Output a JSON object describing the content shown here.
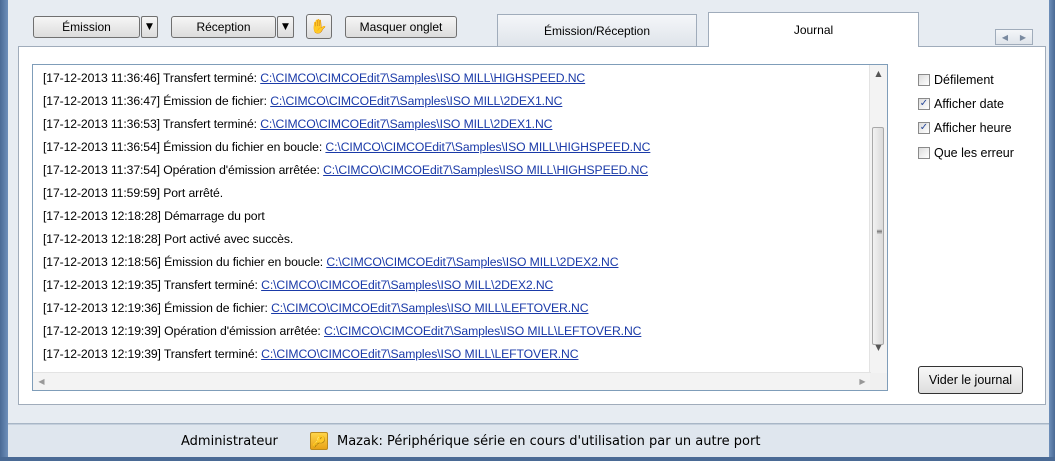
{
  "toolbar": {
    "emission_label": "Émission",
    "reception_label": "Réception",
    "hide_tabs_label": "Masquer onglet",
    "dropdown_glyph": "▼",
    "hand_glyph": "✋"
  },
  "tabs": [
    {
      "label": "Émission/Réception",
      "active": false
    },
    {
      "label": "Journal",
      "active": true
    }
  ],
  "tab_scroll": {
    "left": "◀",
    "right": "▶"
  },
  "log": {
    "lines": [
      {
        "text": "[17-12-2013 11:36:46] Transfert terminé: ",
        "link": "C:\\CIMCO\\CIMCOEdit7\\Samples\\ISO MILL\\HIGHSPEED.NC"
      },
      {
        "text": "[17-12-2013 11:36:47] Émission de fichier: ",
        "link": "C:\\CIMCO\\CIMCOEdit7\\Samples\\ISO MILL\\2DEX1.NC"
      },
      {
        "text": "[17-12-2013 11:36:53] Transfert terminé: ",
        "link": "C:\\CIMCO\\CIMCOEdit7\\Samples\\ISO MILL\\2DEX1.NC"
      },
      {
        "text": "[17-12-2013 11:36:54] Émission du fichier en boucle: ",
        "link": "C:\\CIMCO\\CIMCOEdit7\\Samples\\ISO MILL\\HIGHSPEED.NC"
      },
      {
        "text": "[17-12-2013 11:37:54] Opération d'émission arrêtée: ",
        "link": "C:\\CIMCO\\CIMCOEdit7\\Samples\\ISO MILL\\HIGHSPEED.NC"
      },
      {
        "text": "[17-12-2013 11:59:59] Port arrêté.",
        "link": ""
      },
      {
        "text": "[17-12-2013 12:18:28] Démarrage du port",
        "link": ""
      },
      {
        "text": "[17-12-2013 12:18:28] Port activé avec succès.",
        "link": ""
      },
      {
        "text": "[17-12-2013 12:18:56] Émission du fichier en boucle: ",
        "link": "C:\\CIMCO\\CIMCOEdit7\\Samples\\ISO MILL\\2DEX2.NC"
      },
      {
        "text": "[17-12-2013 12:19:35] Transfert terminé: ",
        "link": "C:\\CIMCO\\CIMCOEdit7\\Samples\\ISO MILL\\2DEX2.NC"
      },
      {
        "text": "[17-12-2013 12:19:36] Émission de fichier: ",
        "link": "C:\\CIMCO\\CIMCOEdit7\\Samples\\ISO MILL\\LEFTOVER.NC"
      },
      {
        "text": "[17-12-2013 12:19:39] Opération d'émission arrêtée: ",
        "link": "C:\\CIMCO\\CIMCOEdit7\\Samples\\ISO MILL\\LEFTOVER.NC"
      },
      {
        "text": "[17-12-2013 12:19:39] Transfert terminé: ",
        "link": "C:\\CIMCO\\CIMCOEdit7\\Samples\\ISO MILL\\LEFTOVER.NC"
      }
    ],
    "link_color": "#1a3aa8",
    "scroll_up": "▲",
    "scroll_down": "▼",
    "scroll_left": "◀",
    "scroll_right": "▶",
    "grip": "≡"
  },
  "options": [
    {
      "label": "Défilement",
      "checked": false
    },
    {
      "label": "Afficher date",
      "checked": true
    },
    {
      "label": "Afficher heure",
      "checked": true
    },
    {
      "label": "Que les erreur",
      "checked": false
    }
  ],
  "clear_button_label": "Vider le journal",
  "status": {
    "user": "Administrateur",
    "message": "Mazak: Périphérique série en cours d'utilisation par un autre port",
    "key_glyph": "🔑"
  }
}
